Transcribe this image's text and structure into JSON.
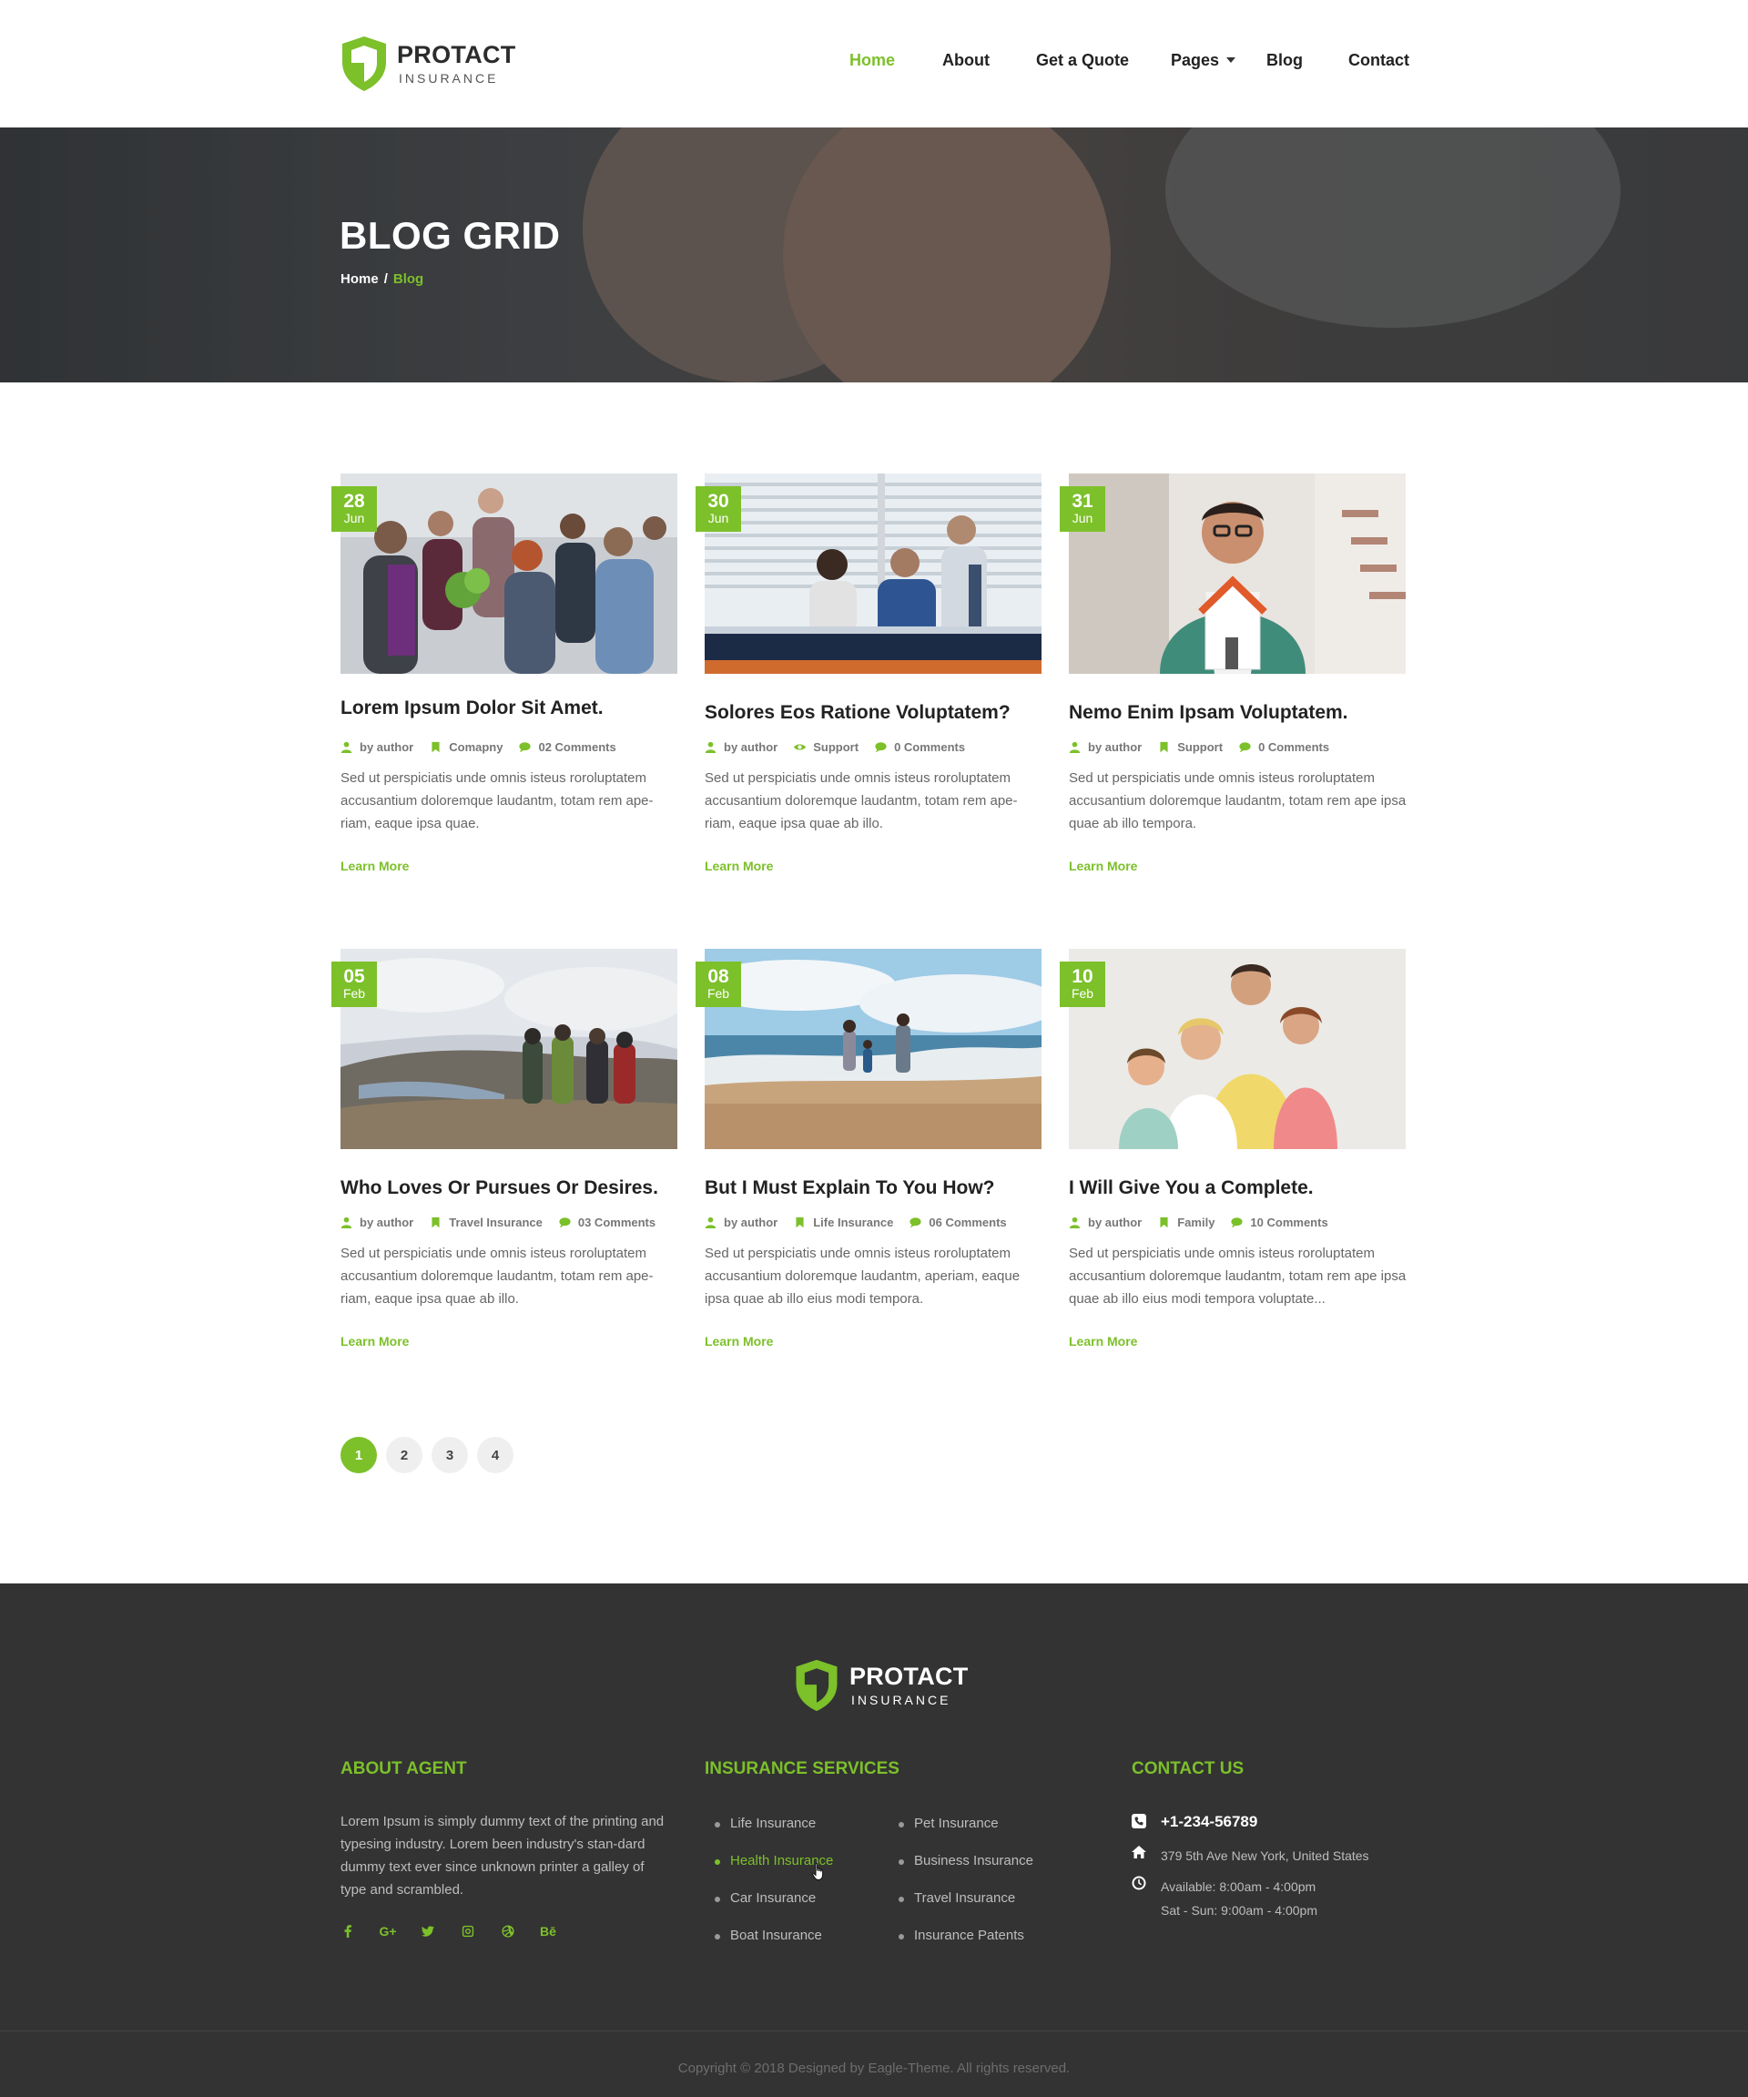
{
  "brand": {
    "name": "PROTACT",
    "tagline": "INSURANCE",
    "accent": "#7cc02a"
  },
  "nav": {
    "items": [
      {
        "label": "Home",
        "active": true
      },
      {
        "label": "About",
        "active": false
      },
      {
        "label": "Get a Quote",
        "active": false
      },
      {
        "label": "Pages",
        "active": false,
        "dropdown": true
      },
      {
        "label": "Blog",
        "active": false
      },
      {
        "label": "Contact",
        "active": false
      }
    ]
  },
  "hero": {
    "title": "BLOG GRID",
    "breadcrumb": {
      "home": "Home",
      "separator": "/",
      "current": "Blog"
    }
  },
  "posts": [
    {
      "day": "28",
      "month": "Jun",
      "title": "Lorem Ipsum Dolor Sit Amet.",
      "author": "by author",
      "category": "Comapny",
      "category_icon": "bookmark-icon",
      "comments": "02 Comments",
      "excerpt": "Sed ut perspiciatis unde omnis isteus roroluptatem accusantium doloremque laudantm, totam rem ape-riam, eaque ipsa quae.",
      "link": "Learn More",
      "image": "group-of-young-people-outdoors"
    },
    {
      "day": "30",
      "month": "Jun",
      "title": "Solores Eos Ratione Voluptatem?",
      "author": "by author",
      "category": "Support",
      "category_icon": "eye-icon",
      "comments": "0 Comments",
      "excerpt": "Sed ut perspiciatis unde omnis isteus roroluptatem accusantium doloremque laudantm, totam rem ape-riam, eaque ipsa quae ab illo.",
      "link": "Learn More",
      "image": "business-meeting-office"
    },
    {
      "day": "31",
      "month": "Jun",
      "title": "Nemo Enim Ipsam Voluptatem.",
      "author": "by author",
      "category": "Support",
      "category_icon": "bookmark-icon",
      "comments": "0 Comments",
      "excerpt": "Sed ut perspiciatis unde omnis isteus roroluptatem accusantium doloremque laudantm, totam rem ape ipsa quae ab illo tempora.",
      "link": "Learn More",
      "image": "man-holding-house-model"
    },
    {
      "day": "05",
      "month": "Feb",
      "title": "Who Loves Or Pursues Or Desires.",
      "author": "by author",
      "category": "Travel Insurance",
      "category_icon": "bookmark-icon",
      "comments": "03 Comments",
      "excerpt": "Sed ut perspiciatis unde omnis isteus roroluptatem accusantium doloremque laudantm, totam rem ape-riam, eaque ipsa quae ab illo.",
      "link": "Learn More",
      "image": "hikers-on-mountain"
    },
    {
      "day": "08",
      "month": "Feb",
      "title": "But I Must Explain To You How?",
      "author": "by author",
      "category": "Life Insurance",
      "category_icon": "bookmark-icon",
      "comments": "06 Comments",
      "excerpt": "Sed ut perspiciatis unde omnis isteus roroluptatem accusantium doloremque laudantm, aperiam, eaque ipsa quae ab illo eius modi tempora.",
      "link": "Learn More",
      "image": "family-at-beach"
    },
    {
      "day": "10",
      "month": "Feb",
      "title": "I Will Give You a Complete.",
      "author": "by author",
      "category": "Family",
      "category_icon": "bookmark-icon",
      "comments": "10 Comments",
      "excerpt": "Sed ut perspiciatis unde omnis isteus roroluptatem accusantium doloremque laudantm, totam rem ape ipsa quae ab illo eius modi tempora voluptate...",
      "link": "Learn More",
      "image": "happy-family-portrait"
    }
  ],
  "pagination": {
    "pages": [
      "1",
      "2",
      "3",
      "4"
    ],
    "current": "1"
  },
  "footer": {
    "brand": {
      "name": "PROTACT",
      "tagline": "INSURANCE"
    },
    "about": {
      "heading": "ABOUT AGENT",
      "text": "Lorem Ipsum is simply dummy text of the printing and typesing industry. Lorem been industry's stan-dard dummy text ever since  unknown printer a galley of type and scrambled.",
      "socials": [
        "facebook-icon",
        "google-plus-icon",
        "twitter-icon",
        "instagram-icon",
        "dribbble-icon",
        "behance-icon"
      ],
      "social_labels": {
        "google_plus": "G+",
        "behance": "Bē"
      }
    },
    "services": {
      "heading": "INSURANCE SERVICES",
      "col1": [
        "Life Insurance",
        "Health Insurance",
        "Car Insurance",
        "Boat Insurance"
      ],
      "col2": [
        "Pet Insurance",
        "Business Insurance",
        "Travel Insurance",
        "Insurance Patents"
      ],
      "hovered": "Health Insurance"
    },
    "contact": {
      "heading": "CONTACT US",
      "phone": "+1-234-56789",
      "address": "379 5th Ave New York, United States",
      "hours_1": "Available: 8:00am - 4:00pm",
      "hours_2": "Sat - Sun: 9:00am - 4:00pm"
    },
    "copyright": "Copyright © 2018 Designed by Eagle-Theme. All rights reserved."
  }
}
